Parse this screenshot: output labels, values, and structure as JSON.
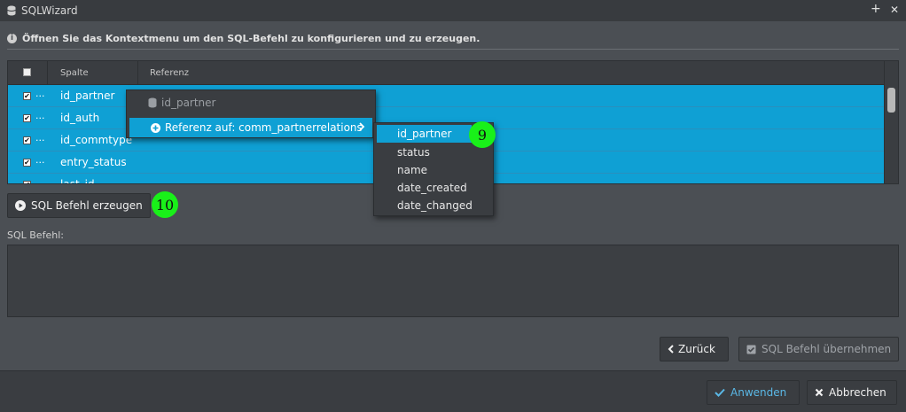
{
  "window": {
    "title": "SQLWizard",
    "add_symbol": "+",
    "close_symbol": "✕"
  },
  "hint": {
    "icon": "info-icon",
    "text": "Öffnen Sie das Kontextmenu um den SQL-Befehl zu konfigurieren und zu erzeugen."
  },
  "grid": {
    "columns": [
      "Spalte",
      "Referenz"
    ],
    "rows": [
      {
        "checked": true,
        "dots": "...",
        "name": "id_partner"
      },
      {
        "checked": true,
        "dots": "...",
        "name": "id_auth"
      },
      {
        "checked": true,
        "dots": "...",
        "name": "id_commtype"
      },
      {
        "checked": true,
        "dots": "...",
        "name": "entry_status"
      },
      {
        "checked": true,
        "dots": "...",
        "name": "last_id"
      }
    ]
  },
  "context_menu": {
    "disabled_item": "id_partner",
    "reference_item": "Referenz auf: comm_partnerrelations",
    "submenu": [
      "id_partner",
      "status",
      "name",
      "date_created",
      "date_changed"
    ]
  },
  "buttons": {
    "generate": "SQL Befehl erzeugen",
    "back": "Zurück",
    "apply_sql": "SQL Befehl übernehmen",
    "apply": "Anwenden",
    "cancel": "Abbrechen"
  },
  "sql_label": "SQL Befehl:",
  "badges": {
    "submenu_badge": "9",
    "generate_badge": "10"
  },
  "colors": {
    "selection": "#0fa0d4",
    "badge": "#19f019",
    "background": "#4b4f54"
  }
}
